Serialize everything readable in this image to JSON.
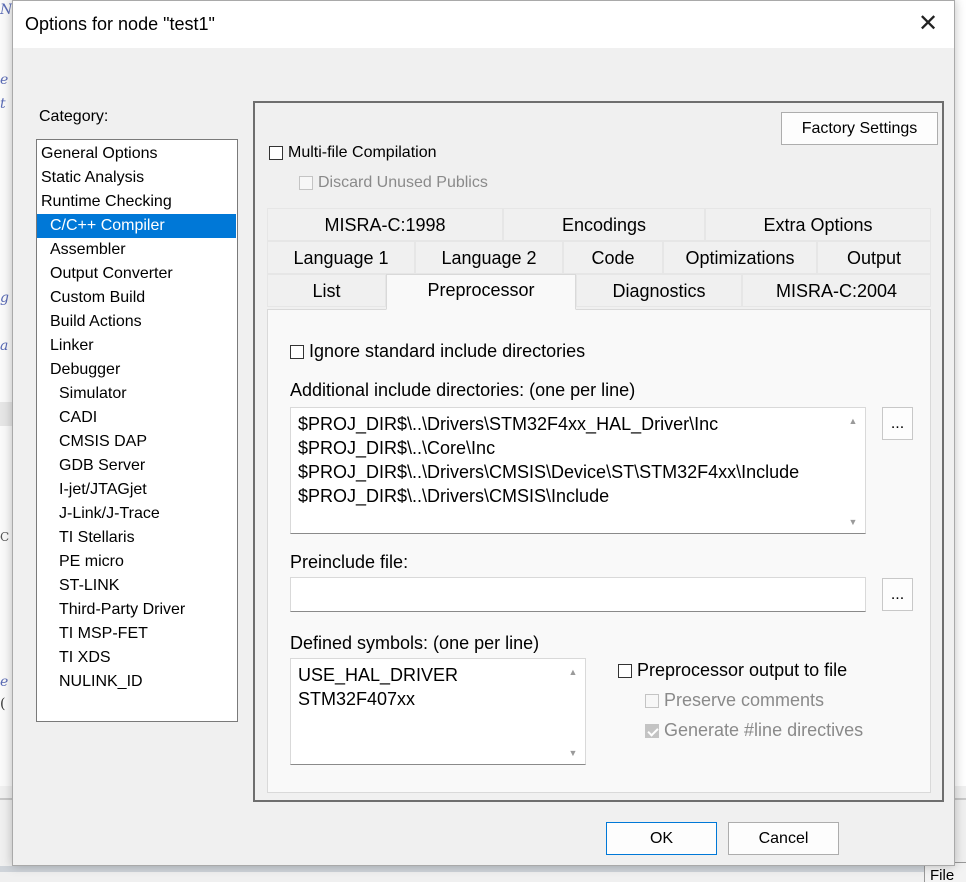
{
  "window": {
    "title": "Options for node \"test1\"",
    "close_glyph": "✕"
  },
  "category": {
    "label": "Category:",
    "items": [
      {
        "label": "General Options",
        "level": 0
      },
      {
        "label": "Static Analysis",
        "level": 0
      },
      {
        "label": "Runtime Checking",
        "level": 0
      },
      {
        "label": "C/C++ Compiler",
        "level": 1,
        "selected": true
      },
      {
        "label": "Assembler",
        "level": 1
      },
      {
        "label": "Output Converter",
        "level": 1
      },
      {
        "label": "Custom Build",
        "level": 1
      },
      {
        "label": "Build Actions",
        "level": 1
      },
      {
        "label": "Linker",
        "level": 1
      },
      {
        "label": "Debugger",
        "level": 1
      },
      {
        "label": "Simulator",
        "level": 2
      },
      {
        "label": "CADI",
        "level": 2
      },
      {
        "label": "CMSIS DAP",
        "level": 2
      },
      {
        "label": "GDB Server",
        "level": 2
      },
      {
        "label": "I-jet/JTAGjet",
        "level": 2
      },
      {
        "label": "J-Link/J-Trace",
        "level": 2
      },
      {
        "label": "TI Stellaris",
        "level": 2
      },
      {
        "label": "PE micro",
        "level": 2
      },
      {
        "label": "ST-LINK",
        "level": 2
      },
      {
        "label": "Third-Party Driver",
        "level": 2
      },
      {
        "label": "TI MSP-FET",
        "level": 2
      },
      {
        "label": "TI XDS",
        "level": 2
      },
      {
        "label": "NULINK_ID",
        "level": 2
      }
    ]
  },
  "panel": {
    "factory_settings": "Factory Settings",
    "multi_file": "Multi-file Compilation",
    "discard_unused": "Discard Unused Publics",
    "tabs": {
      "row1": [
        "MISRA-C:1998",
        "Encodings",
        "Extra Options"
      ],
      "row2": [
        "Language 1",
        "Language 2",
        "Code",
        "Optimizations",
        "Output"
      ],
      "row3": [
        "List",
        "Preprocessor",
        "Diagnostics",
        "MISRA-C:2004"
      ],
      "active": "Preprocessor"
    },
    "preprocessor": {
      "ignore_std": "Ignore standard include directories",
      "include_label": "Additional include directories: (one per line)",
      "include_dirs": [
        "$PROJ_DIR$\\..\\Drivers\\STM32F4xx_HAL_Driver\\Inc",
        "$PROJ_DIR$\\..\\Core\\Inc",
        "$PROJ_DIR$\\..\\Drivers\\CMSIS\\Device\\ST\\STM32F4xx\\Include",
        "$PROJ_DIR$\\..\\Drivers\\CMSIS\\Include"
      ],
      "browse_label": "...",
      "preinclude_label": "Preinclude file:",
      "preinclude_value": "",
      "defined_label": "Defined symbols: (one per line)",
      "defined_symbols": [
        "USE_HAL_DRIVER",
        "STM32F407xx"
      ],
      "pp_output": "Preprocessor output to file",
      "preserve_comments": "Preserve comments",
      "generate_line": "Generate #line directives"
    }
  },
  "buttons": {
    "ok": "OK",
    "cancel": "Cancel"
  },
  "background": {
    "glyphs": [
      "N",
      "e",
      "t",
      "g",
      "a",
      "C",
      "e",
      "(",
      "File"
    ]
  },
  "colors": {
    "selection": "#0078d7",
    "dialog_bg": "#f0f0f0"
  }
}
